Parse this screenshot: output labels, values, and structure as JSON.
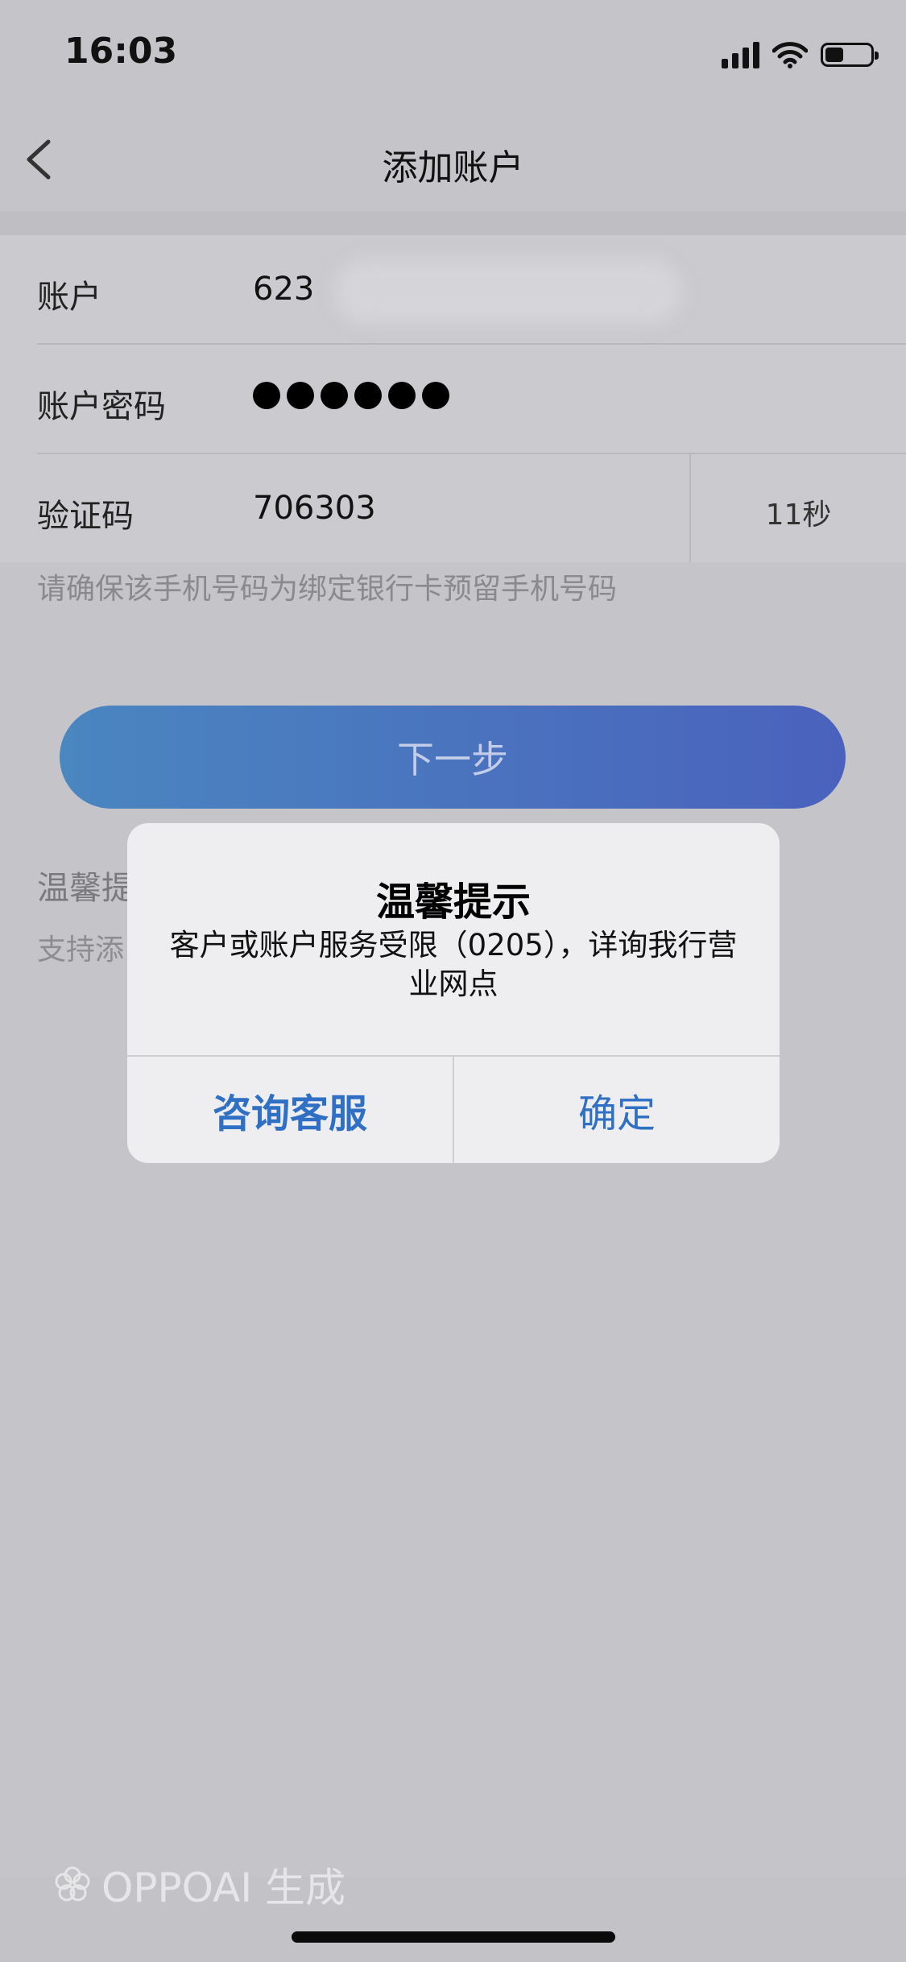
{
  "status_bar": {
    "time": "16:03",
    "battery_level": 0.35,
    "icons": [
      "signal-icon",
      "wifi-icon",
      "battery-icon"
    ]
  },
  "nav": {
    "title": "添加账户",
    "back_icon": "chevron-left-icon"
  },
  "form": {
    "account_label": "账户",
    "account_value": "623",
    "password_label": "账户密码",
    "password_dot_count": 6,
    "code_label": "验证码",
    "code_value": "706303",
    "countdown": "11秒"
  },
  "hint": "请确保该手机号码为绑定银行卡预留手机号码",
  "next_button": "下一步",
  "tips": {
    "title": "温馨提",
    "body": "支持添"
  },
  "dialog": {
    "title": "温馨提示",
    "message": "客户或账户服务受限（0205），详询我行营业网点",
    "left_button": "咨询客服",
    "right_button": "确定"
  },
  "watermark": "OPPOAI 生成",
  "colors": {
    "accent": "#2f6fc4",
    "button_gradient_start": "#4a86c0",
    "button_gradient_end": "#4a62bd"
  }
}
